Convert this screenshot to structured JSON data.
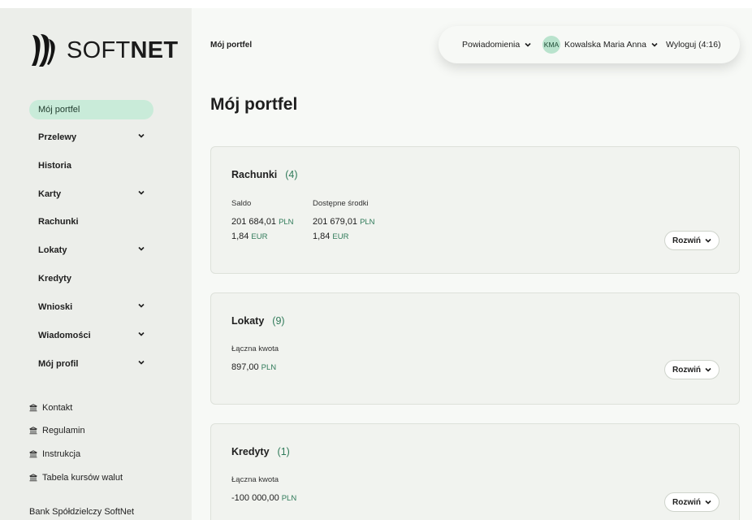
{
  "brand": {
    "name_light": "SOFT",
    "name_bold": "NET"
  },
  "sidebar": {
    "items": [
      {
        "label": "Mój portfel",
        "active": true,
        "has_children": false
      },
      {
        "label": "Przelewy",
        "active": false,
        "has_children": true
      },
      {
        "label": "Historia",
        "active": false,
        "has_children": false
      },
      {
        "label": "Karty",
        "active": false,
        "has_children": true
      },
      {
        "label": "Rachunki",
        "active": false,
        "has_children": false
      },
      {
        "label": "Lokaty",
        "active": false,
        "has_children": true
      },
      {
        "label": "Kredyty",
        "active": false,
        "has_children": false
      },
      {
        "label": "Wnioski",
        "active": false,
        "has_children": true
      },
      {
        "label": "Wiadomości",
        "active": false,
        "has_children": true
      },
      {
        "label": "Mój profil",
        "active": false,
        "has_children": true
      }
    ],
    "links": [
      {
        "label": "Kontakt",
        "icon": "bank-icon"
      },
      {
        "label": "Regulamin",
        "icon": "bank-icon"
      },
      {
        "label": "Instrukcja",
        "icon": "bank-icon"
      },
      {
        "label": "Tabela kursów walut",
        "icon": "bank-icon"
      }
    ],
    "footer": "Bank Spółdzielczy SoftNet"
  },
  "header": {
    "breadcrumb": "Mój portfel",
    "notifications_label": "Powiadomienia",
    "user_initials": "KMA",
    "user_name": "Kowalska Maria Anna",
    "logout_label": "Wyloguj (4:16)"
  },
  "main": {
    "title": "Mój portfel",
    "cards": [
      {
        "title": "Rachunki",
        "count": "(4)",
        "columns": [
          {
            "label": "Saldo",
            "amounts": [
              {
                "value": "201 684,01",
                "currency": "PLN"
              },
              {
                "value": "1,84",
                "currency": "EUR"
              }
            ]
          },
          {
            "label": "Dostępne środki",
            "amounts": [
              {
                "value": "201 679,01",
                "currency": "PLN"
              },
              {
                "value": "1,84",
                "currency": "EUR"
              }
            ]
          }
        ],
        "expand_label": "Rozwiń"
      },
      {
        "title": "Lokaty",
        "count": "(9)",
        "columns": [
          {
            "label": "Łączna kwota",
            "amounts": [
              {
                "value": "897,00",
                "currency": "PLN"
              }
            ]
          }
        ],
        "expand_label": "Rozwiń"
      },
      {
        "title": "Kredyty",
        "count": "(1)",
        "columns": [
          {
            "label": "Łączna kwota",
            "amounts": [
              {
                "value": "-100 000,00",
                "currency": "PLN"
              }
            ]
          }
        ],
        "expand_label": "Rozwiń"
      }
    ]
  },
  "colors": {
    "accent": "#2f7a59",
    "active_nav_bg": "#c9ebd9",
    "sidebar_bg": "#eceeea",
    "main_bg": "#f7f9f6",
    "card_bg": "#f1f3ef"
  }
}
